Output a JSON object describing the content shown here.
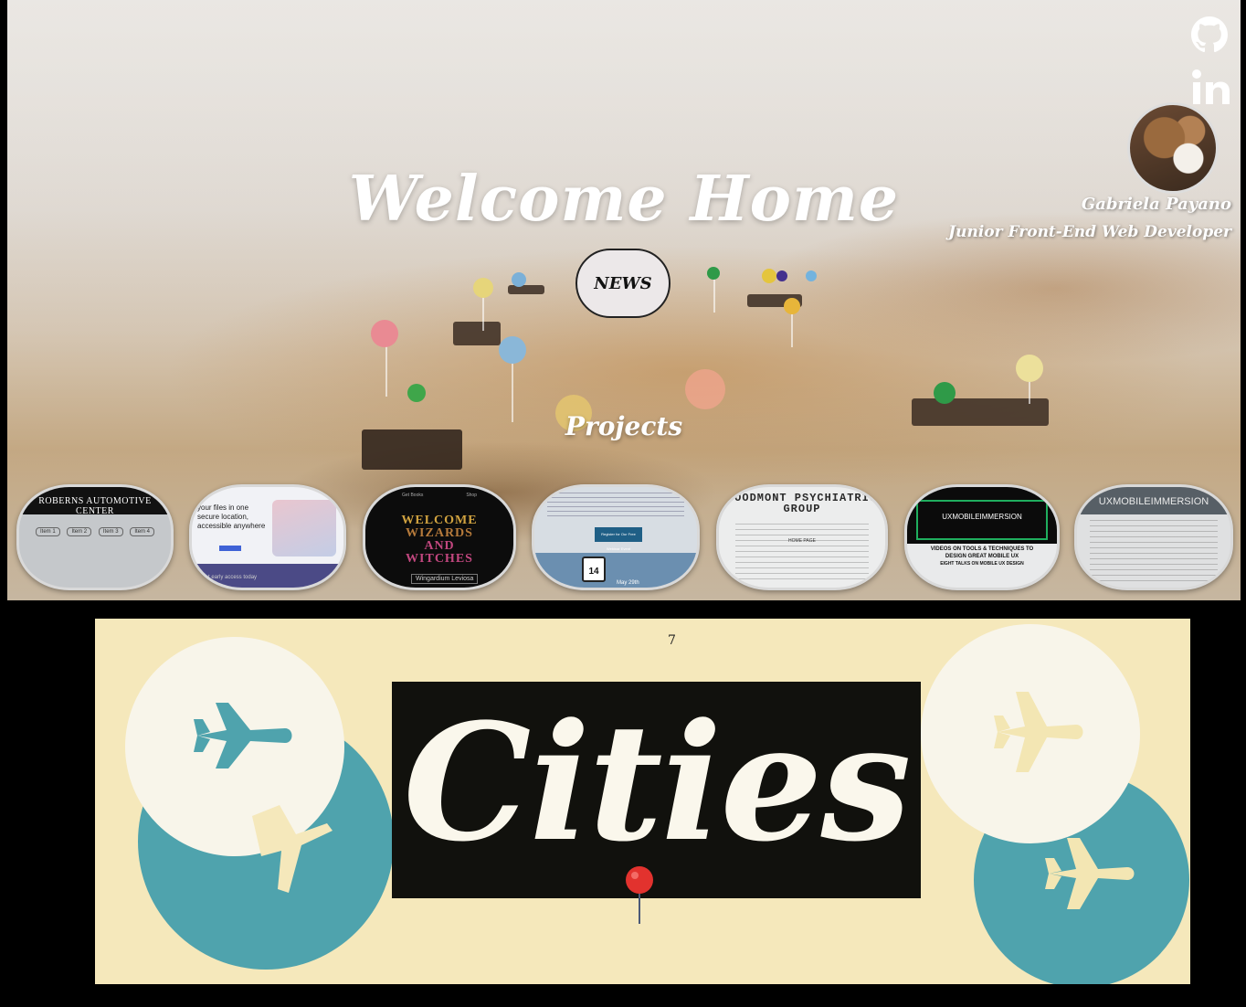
{
  "hero": {
    "welcome_title": "Welcome Home",
    "news_button": "NEWS",
    "projects_title": "Projects"
  },
  "profile": {
    "name": "Gabriela Payano",
    "role": "Junior Front-End Web Developer"
  },
  "social": {
    "github_icon": "github-icon",
    "linkedin_icon": "linkedin-icon",
    "linkedin_text": "in"
  },
  "projects": {
    "roberns": {
      "title": "ROBERNS AUTOMOTIVE CENTER",
      "nav": [
        "Item 1",
        "Item 2",
        "Item 3",
        "Item 4"
      ]
    },
    "fileshare": {
      "headline": "your files in one secure location, accessible anywhere",
      "footer": "Get early access today"
    },
    "wizards": {
      "line1": "WELCOME",
      "line2": "WIZARDS",
      "line3": "AND",
      "line4": "WITCHES",
      "button": "Wingardium Leviosa",
      "nav_left": "Get Books",
      "nav_right": "Shop"
    },
    "calendar": {
      "day": "14",
      "date": "May 29th",
      "cta": "Register for Our Free Webinar Event"
    },
    "psychiatric": {
      "title": "WOODMONT PSYCHIATRIC GROUP",
      "subtitle": "HOME PAGE"
    },
    "ux_mobile": {
      "title": "UXMOBILEIMMERSION",
      "sub1": "VIDEOS ON TOOLS & TECHNIQUES TO",
      "sub2": "DESIGN GREAT MOBILE UX",
      "sub3": "EIGHT TALKS ON MOBILE UX DESIGN"
    },
    "ux_mobile_2": {
      "title": "UXMOBILEIMMERSION"
    }
  },
  "cities": {
    "count": "7",
    "title": "Cities"
  },
  "colors": {
    "banner_bg": "#f5e8bb",
    "teal": "#4fa3ad",
    "cream": "#f8f5ea",
    "pin_red": "#e2322e"
  }
}
